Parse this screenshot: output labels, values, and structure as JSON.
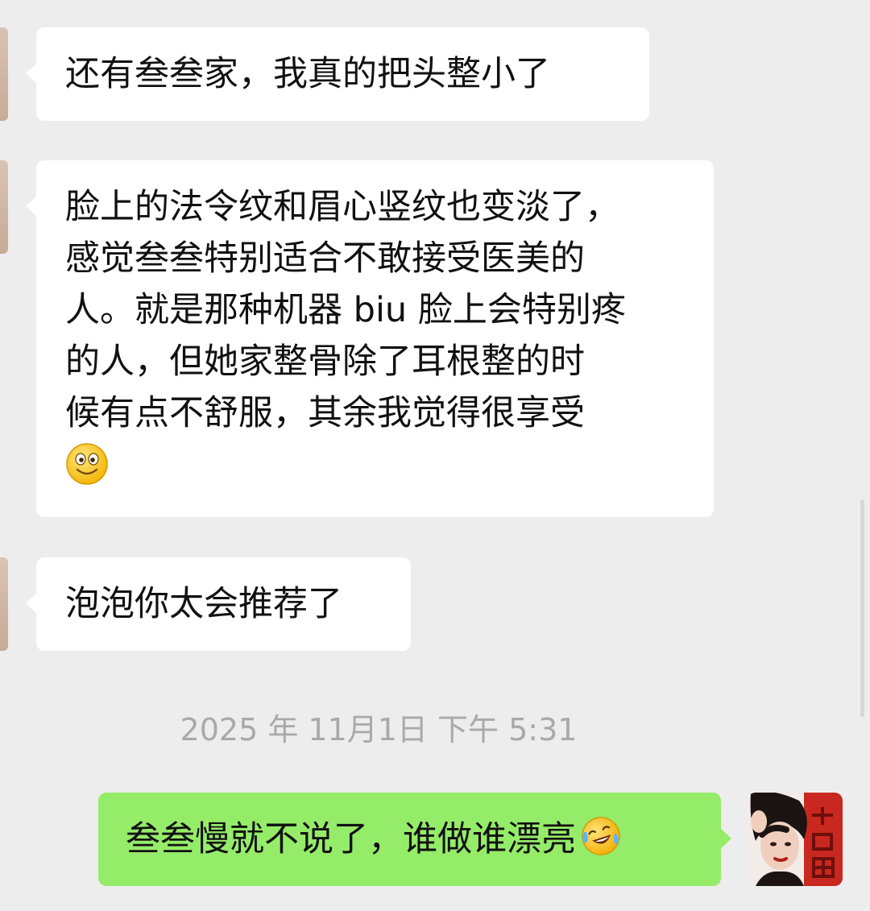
{
  "messages": [
    {
      "side": "incoming",
      "lines": [
        "还有叁叁家，我真的把头整小了"
      ]
    },
    {
      "side": "incoming",
      "lines": [
        "脸上的法令纹和眉心竖纹也变淡了，",
        "感觉叁叁特别适合不敢接受医美的",
        "人。就是那种机器 biu 脸上会特别疼",
        "的人，但她家整骨除了耳根整的时",
        "候有点不舒服，其余我觉得很享受"
      ],
      "trailing_emoji": "smiley-emoji"
    },
    {
      "side": "incoming",
      "lines": [
        "泡泡你太会推荐了"
      ]
    },
    {
      "side": "outgoing",
      "lines": [
        "叁叁慢就不说了，谁做谁漂亮"
      ],
      "trailing_emoji": "laughing-crying-emoji"
    }
  ],
  "timestamp": "2025 年 11月1日 下午 5:31",
  "colors": {
    "background": "#ededed",
    "incoming_bubble": "#ffffff",
    "outgoing_bubble": "#95ec69",
    "timestamp_text": "#a9a9a9",
    "message_text": "#111111"
  },
  "icons": {
    "self_avatar": "user-avatar-photo",
    "other_avatar": "contact-avatar-photo"
  }
}
